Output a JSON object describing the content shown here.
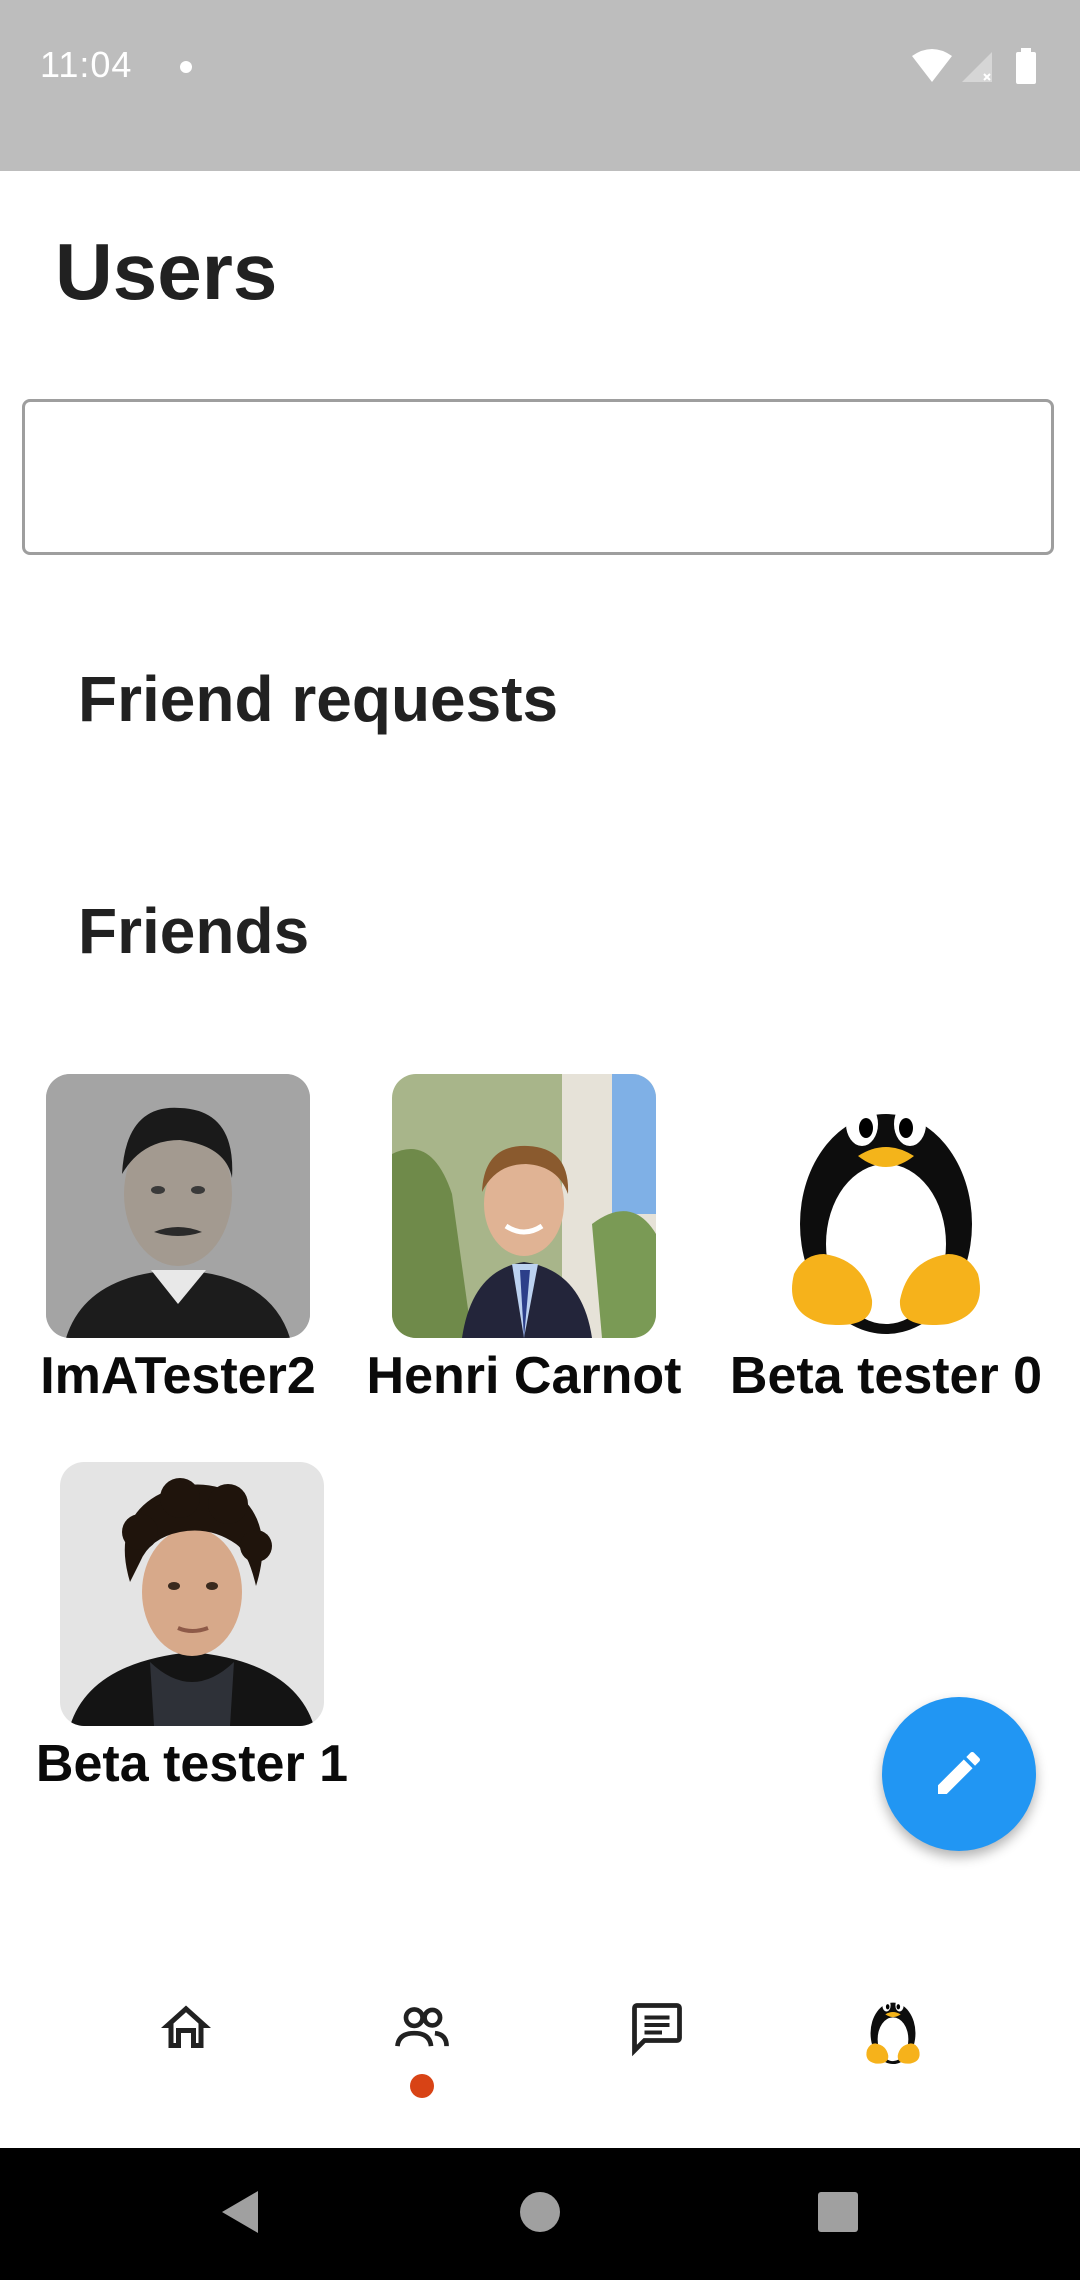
{
  "status_bar": {
    "time": "11:04",
    "icons": [
      "wifi-icon",
      "signal-icon",
      "battery-icon"
    ]
  },
  "page": {
    "title": "Users"
  },
  "search": {
    "value": "",
    "placeholder": ""
  },
  "sections": {
    "friend_requests": "Friend requests",
    "friends": "Friends"
  },
  "friends": [
    {
      "name": "ImATester2",
      "avatar": "portrait-vintage-man"
    },
    {
      "name": "Henri Carnot",
      "avatar": "portrait-young-man-suit"
    },
    {
      "name": "Beta tester 0",
      "avatar": "penguin-mascot"
    },
    {
      "name": "Beta tester 1",
      "avatar": "portrait-man-curly-hair"
    }
  ],
  "fab": {
    "icon": "pencil-icon"
  },
  "bottom_nav": {
    "items": [
      "home-icon",
      "people-icon",
      "chat-icon",
      "profile-avatar-penguin"
    ],
    "active_index": 1
  },
  "colors": {
    "status_bar": "#bdbdbd",
    "fab": "#2196f3",
    "active_indicator": "#d84315"
  }
}
